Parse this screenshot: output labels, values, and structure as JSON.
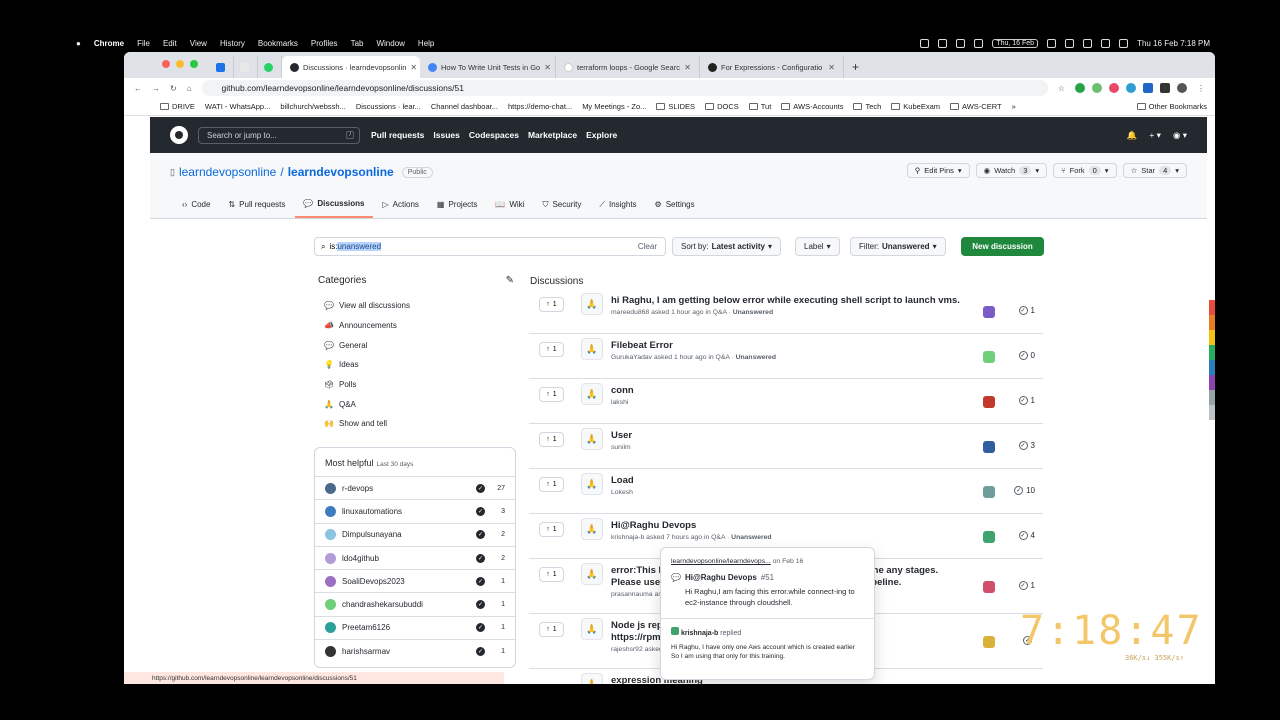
{
  "menubar": {
    "app": "Chrome",
    "items": [
      "File",
      "Edit",
      "View",
      "History",
      "Bookmarks",
      "Profiles",
      "Tab",
      "Window",
      "Help"
    ],
    "date_badge": "Thu, 16 Feb",
    "datetime": "Thu 16 Feb  7:18 PM"
  },
  "tabs": [
    {
      "label": "Discussions · learndevopsonlin",
      "active": true
    },
    {
      "label": "How To Write Unit Tests in Go"
    },
    {
      "label": "terraform loops - Google Searc"
    },
    {
      "label": "For Expressions - Configuratio"
    }
  ],
  "address": {
    "url": "github.com/learndevopsonline/learndevopsonline/discussions/51"
  },
  "bookmarks": [
    "DRIVE",
    "WATI - WhatsApp...",
    "billchurch/webssh...",
    "Discussions · lear...",
    "Channel dashboar...",
    "https://demo-chat...",
    "My Meetings - Zo...",
    "SLIDES",
    "DOCS",
    "Tut",
    "AWS-Accounts",
    "Tech",
    "KubeExam",
    "AWS-CERT",
    "»",
    "Other Bookmarks"
  ],
  "github": {
    "search_placeholder": "Search or jump to...",
    "search_key": "/",
    "nav": [
      "Pull requests",
      "Issues",
      "Codespaces",
      "Marketplace",
      "Explore"
    ]
  },
  "repo": {
    "owner": "learndevopsonline",
    "sep": "/",
    "name": "learndevopsonline",
    "visibility": "Public",
    "buttons": {
      "edit_pins": "Edit Pins",
      "watch": "Watch",
      "watch_count": "3",
      "fork": "Fork",
      "fork_count": "0",
      "star": "Star",
      "star_count": "4"
    },
    "nav": [
      "Code",
      "Pull requests",
      "Discussions",
      "Actions",
      "Projects",
      "Wiki",
      "Security",
      "Insights",
      "Settings"
    ]
  },
  "filter": {
    "prefix": "is:",
    "query": "unanswered",
    "clear": "Clear",
    "sort_label": "Sort by:",
    "sort_value": "Latest activity",
    "label_btn": "Label",
    "filter_label": "Filter:",
    "filter_value": "Unanswered",
    "new_discussion": "New discussion"
  },
  "categories": {
    "title": "Categories",
    "items": [
      {
        "emoji": "💬",
        "label": "View all discussions"
      },
      {
        "emoji": "📣",
        "label": "Announcements"
      },
      {
        "emoji": "💬",
        "label": "General"
      },
      {
        "emoji": "💡",
        "label": "Ideas"
      },
      {
        "emoji": "🗳",
        "label": "Polls"
      },
      {
        "emoji": "🙏",
        "label": "Q&A"
      },
      {
        "emoji": "🙌",
        "label": "Show and tell"
      }
    ]
  },
  "most_helpful": {
    "title": "Most helpful",
    "period": "Last 30 days",
    "users": [
      {
        "name": "r-devops",
        "count": "27",
        "color": "#4a6a8a"
      },
      {
        "name": "linuxautomations",
        "count": "3",
        "color": "#3b7dbf"
      },
      {
        "name": "Dimpulsunayana",
        "count": "2",
        "color": "#8bc3e0"
      },
      {
        "name": "ldo4github",
        "count": "2",
        "color": "#b19bd9"
      },
      {
        "name": "SoaliDevops2023",
        "count": "1",
        "color": "#9a6fc4"
      },
      {
        "name": "chandrashekarsubuddi",
        "count": "1",
        "color": "#6fcf7a"
      },
      {
        "name": "Preetam6126",
        "count": "1",
        "color": "#2aa198"
      },
      {
        "name": "harishsarmav",
        "count": "1",
        "color": "#333333"
      }
    ]
  },
  "discussions": {
    "title": "Discussions",
    "items": [
      {
        "votes": "1",
        "title": "hi Raghu, I am getting below error while executing shell script to launch vms.",
        "author": "mareedu868",
        "meta": "asked 1 hour ago in Q&A ·",
        "status": "Unanswered",
        "answers": "1",
        "color": "#7b5cc4"
      },
      {
        "votes": "1",
        "title": "Filebeat Error",
        "author": "GurukaYadav",
        "meta": "asked 1 hour ago in Q&A ·",
        "status": "Unanswered",
        "answers": "0",
        "color": "#6fcf7a"
      },
      {
        "votes": "1",
        "title": "conn",
        "author": "lakshi",
        "meta": "",
        "status": "",
        "answers": "1",
        "color": "#c0392b"
      },
      {
        "votes": "1",
        "title": "User",
        "author": "sunilm",
        "meta": "",
        "status": "",
        "answers": "3",
        "color": "#2f5d9e"
      },
      {
        "votes": "1",
        "title": "Load",
        "author": "Lokesh",
        "meta": "",
        "status": "",
        "answers": "10",
        "color": "#6d9e9a"
      },
      {
        "votes": "1",
        "title": "Hi@Raghu Devops",
        "author": "krishnaja-b",
        "meta": "asked 7 hours ago in Q&A ·",
        "status": "Unanswered",
        "answers": "4",
        "color": "#3ea36d"
      },
      {
        "votes": "1",
        "title": "error:This Pipeline has run successfully, but does not define any stages. Please use the stage step to define some stages in this Pipeline.",
        "author": "prasannauma",
        "meta": "asked 19 hours ago in Q&A ·",
        "status": "Unanswered",
        "answers": "1",
        "color": "#d0506a"
      },
      {
        "votes": "1",
        "title": "Node js repo not installing in User server using curl -sL https://rpm.nodesource.com/setup_lts.x",
        "author": "rajeshsr92",
        "meta": "asked yesterday in Q&A ·",
        "status": "Unanswered",
        "answers": "",
        "color": "#d9b13b"
      },
      {
        "votes": "",
        "title": "expression meaning",
        "author": "",
        "meta": "",
        "status": "",
        "answers": "",
        "color": "#999999"
      }
    ]
  },
  "hovercard": {
    "repo": "learndevopsonline/learndevops...",
    "date": "on Feb 16",
    "title": "Hi@Raghu Devops",
    "number": "#51",
    "body": "Hi Raghu,I am facing this error.while connect-ing to ec2-instance through cloudshell.",
    "replier": "krishnaja-b",
    "replied": "replied",
    "reply": "Hi Raghu, I have only one Aws account which is created earlier  So I am using that only for this training."
  },
  "statusbar": {
    "url": "https://github.com/learndevopsonline/learndevopsonline/discussions/51"
  },
  "overlay": {
    "clock": "7:18:47",
    "net": "36K/s↓ 355K/s↑"
  }
}
